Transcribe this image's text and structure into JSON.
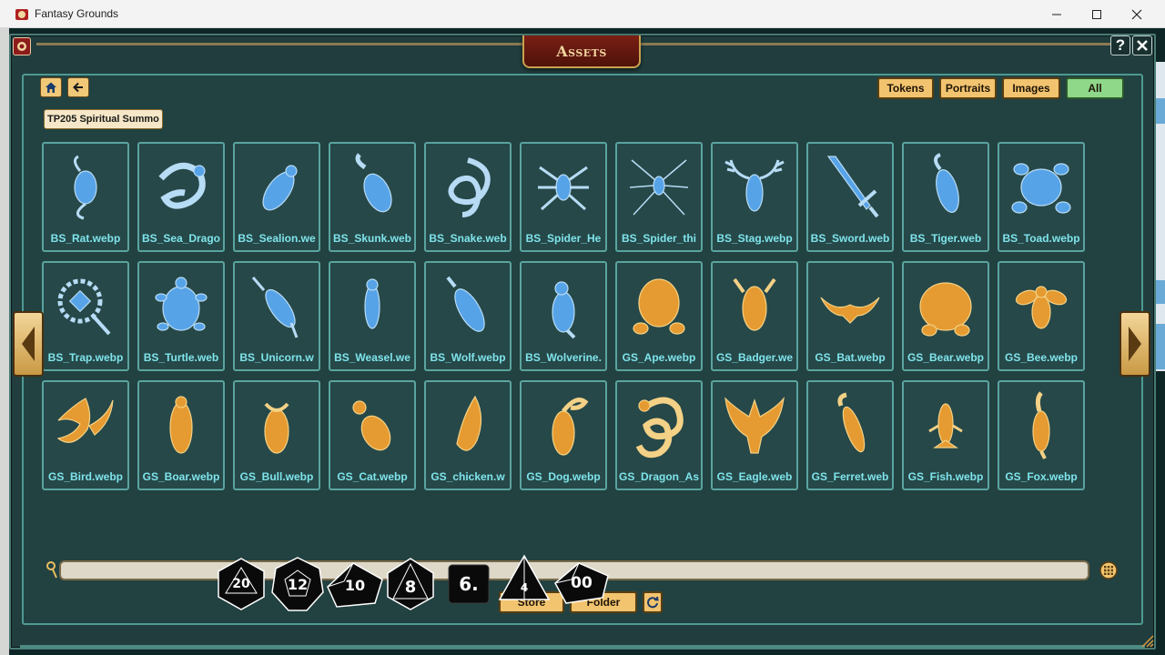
{
  "window": {
    "title": "Fantasy Grounds",
    "controls": [
      "minimize",
      "maximize",
      "close"
    ]
  },
  "panel": {
    "title": "Assets",
    "help_label": "?",
    "path_label": "TP205 Spiritual Summo"
  },
  "filters": [
    {
      "label": "Tokens",
      "active": false
    },
    {
      "label": "Portraits",
      "active": false
    },
    {
      "label": "Images",
      "active": false
    },
    {
      "label": "All",
      "active": true
    }
  ],
  "assets": [
    {
      "name": "BS_Rat.webp",
      "icon": "rat",
      "tint": "blue"
    },
    {
      "name": "BS_Sea_Drago",
      "icon": "sea-dragon",
      "tint": "blue"
    },
    {
      "name": "BS_Sealion.we",
      "icon": "sealion",
      "tint": "blue"
    },
    {
      "name": "BS_Skunk.web",
      "icon": "skunk",
      "tint": "blue"
    },
    {
      "name": "BS_Snake.web",
      "icon": "snake",
      "tint": "blue"
    },
    {
      "name": "BS_Spider_He",
      "icon": "spider",
      "tint": "blue"
    },
    {
      "name": "BS_Spider_thi",
      "icon": "spider-thin",
      "tint": "blue"
    },
    {
      "name": "BS_Stag.webp",
      "icon": "stag",
      "tint": "blue"
    },
    {
      "name": "BS_Sword.web",
      "icon": "sword",
      "tint": "blue"
    },
    {
      "name": "BS_Tiger.web",
      "icon": "tiger",
      "tint": "blue"
    },
    {
      "name": "BS_Toad.webp",
      "icon": "toad",
      "tint": "blue"
    },
    {
      "name": "BS_Trap.webp",
      "icon": "trap",
      "tint": "blue"
    },
    {
      "name": "BS_Turtle.web",
      "icon": "turtle",
      "tint": "blue"
    },
    {
      "name": "BS_Unicorn.w",
      "icon": "unicorn",
      "tint": "blue"
    },
    {
      "name": "BS_Weasel.we",
      "icon": "weasel",
      "tint": "blue"
    },
    {
      "name": "BS_Wolf.webp",
      "icon": "wolf",
      "tint": "blue"
    },
    {
      "name": "BS_Wolverine.",
      "icon": "wolverine",
      "tint": "blue"
    },
    {
      "name": "GS_Ape.webp",
      "icon": "ape",
      "tint": "gold"
    },
    {
      "name": "GS_Badger.we",
      "icon": "badger",
      "tint": "gold"
    },
    {
      "name": "GS_Bat.webp",
      "icon": "bat",
      "tint": "gold"
    },
    {
      "name": "GS_Bear.webp",
      "icon": "bear",
      "tint": "gold"
    },
    {
      "name": "GS_Bee.webp",
      "icon": "bee",
      "tint": "gold"
    },
    {
      "name": "GS_Bird.webp",
      "icon": "bird",
      "tint": "gold"
    },
    {
      "name": "GS_Boar.webp",
      "icon": "boar",
      "tint": "gold"
    },
    {
      "name": "GS_Bull.webp",
      "icon": "bull",
      "tint": "gold"
    },
    {
      "name": "GS_Cat.webp",
      "icon": "cat",
      "tint": "gold"
    },
    {
      "name": "GS_chicken.w",
      "icon": "chicken",
      "tint": "gold"
    },
    {
      "name": "GS_Dog.webp",
      "icon": "dog",
      "tint": "gold"
    },
    {
      "name": "GS_Dragon_As",
      "icon": "dragon",
      "tint": "gold"
    },
    {
      "name": "GS_Eagle.web",
      "icon": "eagle",
      "tint": "gold"
    },
    {
      "name": "GS_Ferret.web",
      "icon": "ferret",
      "tint": "gold"
    },
    {
      "name": "GS_Fish.webp",
      "icon": "fish",
      "tint": "gold"
    },
    {
      "name": "GS_Fox.webp",
      "icon": "fox",
      "tint": "gold"
    }
  ],
  "search": {
    "value": "",
    "placeholder": ""
  },
  "bottom_buttons": {
    "store": "Store",
    "folder": "Folder"
  },
  "dice": [
    {
      "label": "20",
      "type": "d20"
    },
    {
      "label": "12",
      "type": "d12"
    },
    {
      "label": "10",
      "type": "d10"
    },
    {
      "label": "8",
      "type": "d8"
    },
    {
      "label": "6.",
      "type": "d6"
    },
    {
      "label": "4",
      "type": "d4"
    },
    {
      "label": "00",
      "type": "d100"
    }
  ],
  "colors": {
    "panel_bg": "#213d3d",
    "tile_border": "#5aa4a0",
    "tile_label": "#7fe4ec",
    "button_gold": "#f2c46f",
    "active_green": "#8fd88a",
    "blue_token": "#5aa8f0",
    "gold_token": "#f0a030"
  }
}
